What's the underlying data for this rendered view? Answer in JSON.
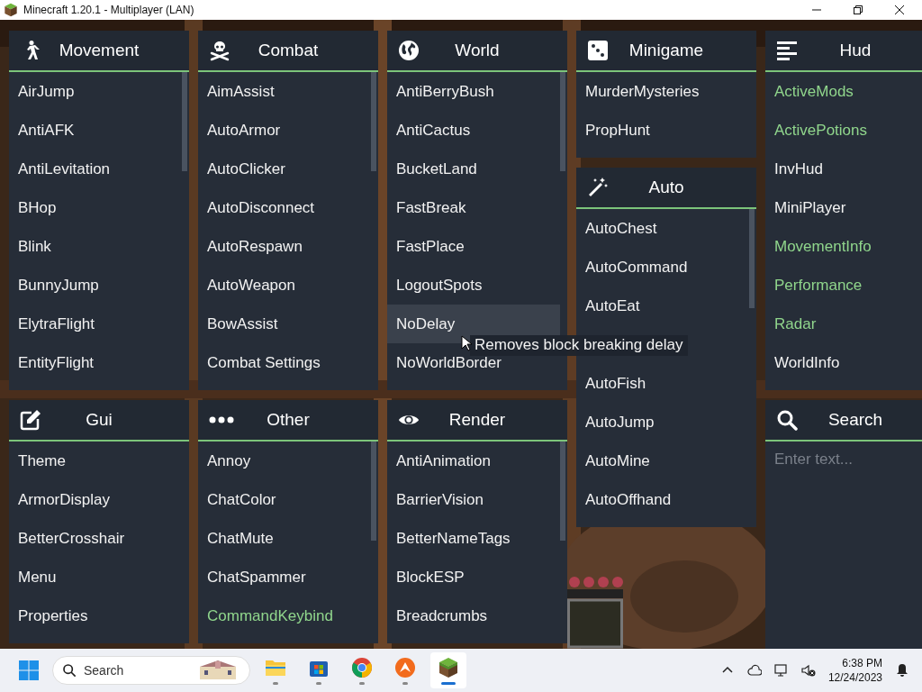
{
  "window": {
    "title": "Minecraft 1.20.1 - Multiplayer (LAN)"
  },
  "columns": [
    {
      "panels": [
        {
          "kind": "modules",
          "title": "Movement",
          "items": [
            {
              "label": "AirJump",
              "enabled": false,
              "hovered": false
            },
            {
              "label": "AntiAFK",
              "enabled": false,
              "hovered": false
            },
            {
              "label": "AntiLevitation",
              "enabled": false,
              "hovered": false
            },
            {
              "label": "BHop",
              "enabled": false,
              "hovered": false
            },
            {
              "label": "Blink",
              "enabled": false,
              "hovered": false
            },
            {
              "label": "BunnyJump",
              "enabled": false,
              "hovered": false
            },
            {
              "label": "ElytraFlight",
              "enabled": false,
              "hovered": false
            },
            {
              "label": "EntityFlight",
              "enabled": false,
              "hovered": false
            }
          ]
        },
        {
          "kind": "modules",
          "title": "Gui",
          "items": [
            {
              "label": "Theme",
              "enabled": false,
              "hovered": false
            },
            {
              "label": "ArmorDisplay",
              "enabled": false,
              "hovered": false
            },
            {
              "label": "BetterCrosshair",
              "enabled": false,
              "hovered": false
            },
            {
              "label": "Menu",
              "enabled": false,
              "hovered": false
            },
            {
              "label": "Properties",
              "enabled": false,
              "hovered": false
            }
          ]
        }
      ]
    },
    {
      "panels": [
        {
          "kind": "modules",
          "title": "Combat",
          "items": [
            {
              "label": "AimAssist",
              "enabled": false,
              "hovered": false
            },
            {
              "label": "AutoArmor",
              "enabled": false,
              "hovered": false
            },
            {
              "label": "AutoClicker",
              "enabled": false,
              "hovered": false
            },
            {
              "label": "AutoDisconnect",
              "enabled": false,
              "hovered": false
            },
            {
              "label": "AutoRespawn",
              "enabled": false,
              "hovered": false
            },
            {
              "label": "AutoWeapon",
              "enabled": false,
              "hovered": false
            },
            {
              "label": "BowAssist",
              "enabled": false,
              "hovered": false
            },
            {
              "label": "Combat Settings",
              "enabled": false,
              "hovered": false
            }
          ]
        },
        {
          "kind": "modules",
          "title": "Other",
          "items": [
            {
              "label": "Annoy",
              "enabled": false,
              "hovered": false
            },
            {
              "label": "ChatColor",
              "enabled": false,
              "hovered": false
            },
            {
              "label": "ChatMute",
              "enabled": false,
              "hovered": false
            },
            {
              "label": "ChatSpammer",
              "enabled": false,
              "hovered": false
            },
            {
              "label": "CommandKeybind",
              "enabled": true,
              "hovered": false
            }
          ]
        }
      ]
    },
    {
      "panels": [
        {
          "kind": "modules",
          "title": "World",
          "items": [
            {
              "label": "AntiBerryBush",
              "enabled": false,
              "hovered": false
            },
            {
              "label": "AntiCactus",
              "enabled": false,
              "hovered": false
            },
            {
              "label": "BucketLand",
              "enabled": false,
              "hovered": false
            },
            {
              "label": "FastBreak",
              "enabled": false,
              "hovered": false
            },
            {
              "label": "FastPlace",
              "enabled": false,
              "hovered": false
            },
            {
              "label": "LogoutSpots",
              "enabled": false,
              "hovered": false
            },
            {
              "label": "NoDelay",
              "enabled": false,
              "hovered": true
            },
            {
              "label": "NoWorldBorder",
              "enabled": false,
              "hovered": false
            }
          ]
        },
        {
          "kind": "modules",
          "title": "Render",
          "items": [
            {
              "label": "AntiAnimation",
              "enabled": false,
              "hovered": false
            },
            {
              "label": "BarrierVision",
              "enabled": false,
              "hovered": false
            },
            {
              "label": "BetterNameTags",
              "enabled": false,
              "hovered": false
            },
            {
              "label": "BlockESP",
              "enabled": false,
              "hovered": false
            },
            {
              "label": "Breadcrumbs",
              "enabled": false,
              "hovered": false
            }
          ]
        }
      ]
    },
    {
      "panels": [
        {
          "kind": "modules",
          "title": "Minigame",
          "items": [
            {
              "label": "MurderMysteries",
              "enabled": false,
              "hovered": false
            },
            {
              "label": "PropHunt",
              "enabled": false,
              "hovered": false
            }
          ]
        },
        {
          "kind": "modules",
          "title": "Auto",
          "items": [
            {
              "label": "AutoChest",
              "enabled": false,
              "hovered": false
            },
            {
              "label": "AutoCommand",
              "enabled": false,
              "hovered": false
            },
            {
              "label": "AutoEat",
              "enabled": false,
              "hovered": false
            },
            {
              "label": "AutoFish",
              "enabled": false,
              "hovered": false
            },
            {
              "label": "AutoJump",
              "enabled": false,
              "hovered": false
            },
            {
              "label": "AutoMine",
              "enabled": false,
              "hovered": false
            },
            {
              "label": "AutoOffhand",
              "enabled": false,
              "hovered": false
            }
          ]
        }
      ]
    },
    {
      "panels": [
        {
          "kind": "modules",
          "title": "Hud",
          "items": [
            {
              "label": "ActiveMods",
              "enabled": true,
              "hovered": false
            },
            {
              "label": "ActivePotions",
              "enabled": true,
              "hovered": false
            },
            {
              "label": "InvHud",
              "enabled": false,
              "hovered": false
            },
            {
              "label": "MiniPlayer",
              "enabled": false,
              "hovered": false
            },
            {
              "label": "MovementInfo",
              "enabled": true,
              "hovered": false
            },
            {
              "label": "Performance",
              "enabled": true,
              "hovered": false
            },
            {
              "label": "Radar",
              "enabled": true,
              "hovered": false
            },
            {
              "label": "WorldInfo",
              "enabled": false,
              "hovered": false
            }
          ]
        },
        {
          "kind": "search",
          "title": "Search",
          "placeholder": "Enter text..."
        }
      ]
    }
  ],
  "tooltip": {
    "text": "Removes block breaking delay"
  },
  "taskbar": {
    "search_placeholder": "Search",
    "apps": [
      {
        "kind": "files",
        "selected": false
      },
      {
        "kind": "store",
        "selected": false
      },
      {
        "kind": "chrome",
        "selected": false
      },
      {
        "kind": "orange",
        "selected": false
      },
      {
        "kind": "minecraft",
        "selected": true
      }
    ],
    "time": "6:38 PM",
    "date": "12/24/2023"
  }
}
